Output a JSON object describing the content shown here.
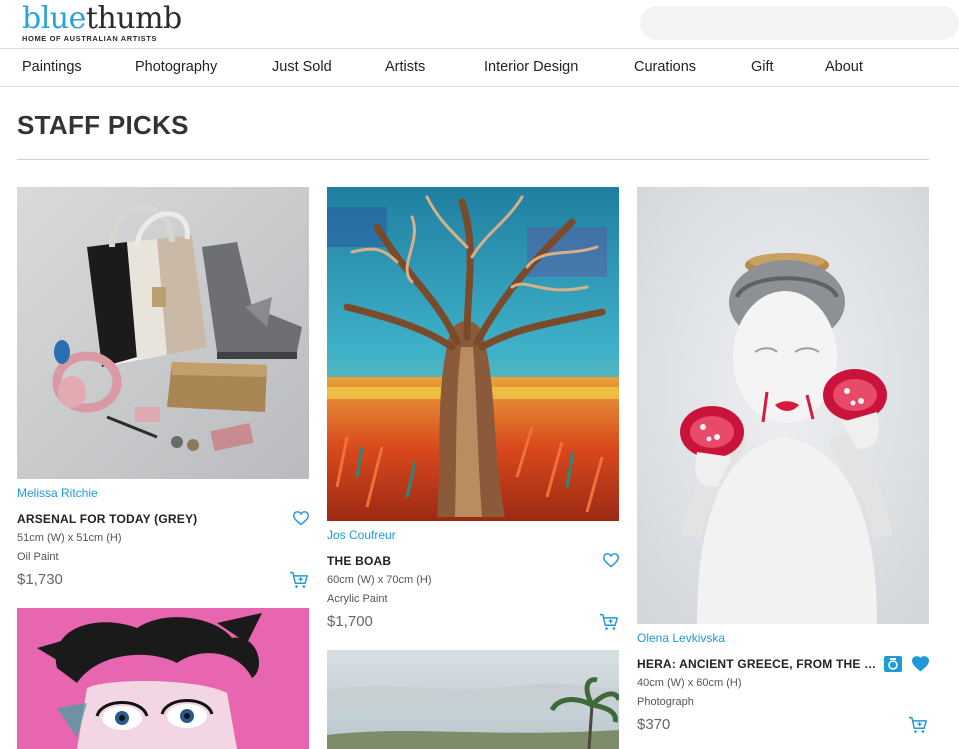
{
  "brand": {
    "logo_part1": "blue",
    "logo_part2": "thumb",
    "tagline": "HOME OF AUSTRALIAN ARTISTS",
    "accent_color": "#29a3d8"
  },
  "nav": {
    "items": [
      {
        "label": "Paintings"
      },
      {
        "label": "Photography"
      },
      {
        "label": "Just Sold"
      },
      {
        "label": "Artists"
      },
      {
        "label": "Interior Design"
      },
      {
        "label": "Curations"
      },
      {
        "label": "Gift"
      },
      {
        "label": "About"
      }
    ]
  },
  "page": {
    "title": "STAFF PICKS"
  },
  "cards": [
    {
      "artist": "Melissa Ritchie",
      "title": "ARSENAL FOR TODAY (GREY)",
      "dims": "51cm (W) x 51cm (H)",
      "medium": "Oil Paint",
      "price": "$1,730",
      "favourited": false,
      "icons": [
        "heart-outline-icon",
        "add-to-cart-icon"
      ]
    },
    {
      "artist": "Jos Coufreur",
      "title": "THE BOAB",
      "dims": "60cm (W) x 70cm (H)",
      "medium": "Acrylic Paint",
      "price": "$1,700",
      "favourited": false,
      "icons": [
        "heart-outline-icon",
        "add-to-cart-icon"
      ]
    },
    {
      "artist": "Olena Levkivska",
      "title": "HERA: ANCIENT GREECE, FROM THE MUS...",
      "dims": "40cm (W) x 60cm (H)",
      "medium": "Photograph",
      "price": "$370",
      "favourited": true,
      "icons": [
        "camera-icon",
        "heart-filled-icon",
        "add-to-cart-icon"
      ]
    }
  ]
}
